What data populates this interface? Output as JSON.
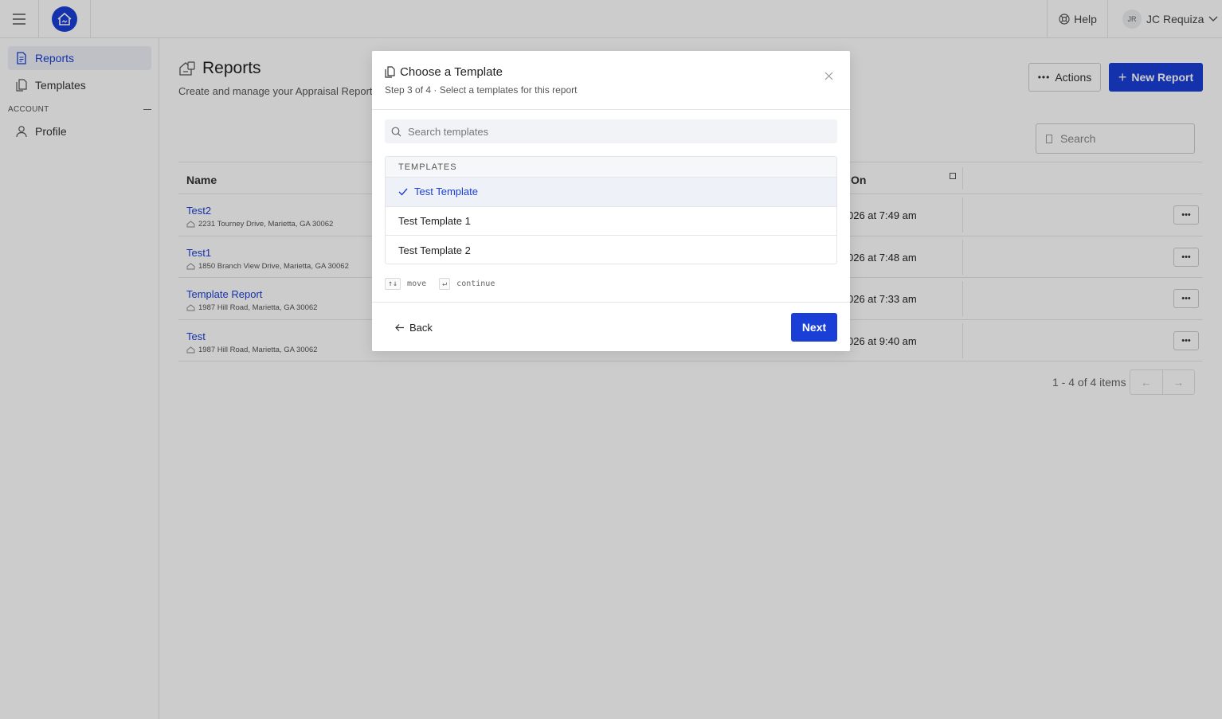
{
  "topbar": {
    "help_label": "Help",
    "user_initials": "JR",
    "user_name": "JC Requiza"
  },
  "sidebar": {
    "items": [
      {
        "label": "Reports",
        "icon": "document-icon",
        "active": true
      },
      {
        "label": "Templates",
        "icon": "copy-icon",
        "active": false
      }
    ],
    "section_label": "ACCOUNT",
    "account_items": [
      {
        "label": "Profile",
        "icon": "user-icon"
      }
    ]
  },
  "page": {
    "title": "Reports",
    "subtitle": "Create and manage your Appraisal Reports",
    "actions_label": "Actions",
    "new_report_label": "New Report",
    "search_placeholder": "Search"
  },
  "table": {
    "headers": {
      "name": "Name",
      "created_on": "On"
    },
    "rows": [
      {
        "name": "Test2",
        "address": "2231 Tourney Drive, Marietta, GA 30062",
        "date": "026 at 7:49 am"
      },
      {
        "name": "Test1",
        "address": "1850 Branch View Drive, Marietta, GA 30062",
        "date": "026 at 7:48 am"
      },
      {
        "name": "Template Report",
        "address": "1987 Hill Road, Marietta, GA 30062",
        "date": "026 at 7:33 am"
      },
      {
        "name": "Test",
        "address": "1987 Hill Road, Marietta, GA 30062",
        "date": "026 at 9:40 am"
      }
    ],
    "pager_text": "1 - 4 of 4 items"
  },
  "modal": {
    "title": "Choose a Template",
    "step": "Step 3 of 4 · Select a templates for this report",
    "search_placeholder": "Search templates",
    "list_header": "TEMPLATES",
    "items": [
      {
        "label": "Test Template",
        "selected": true
      },
      {
        "label": "Test Template 1",
        "selected": false
      },
      {
        "label": "Test Template 2",
        "selected": false
      }
    ],
    "hints": {
      "move_key": "↑↓",
      "move_label": "move",
      "continue_key": "↵",
      "continue_label": "continue"
    },
    "back_label": "Back",
    "next_label": "Next"
  },
  "colors": {
    "accent": "#1a3fd6",
    "overlay": "rgba(0,0,0,0.2)"
  }
}
